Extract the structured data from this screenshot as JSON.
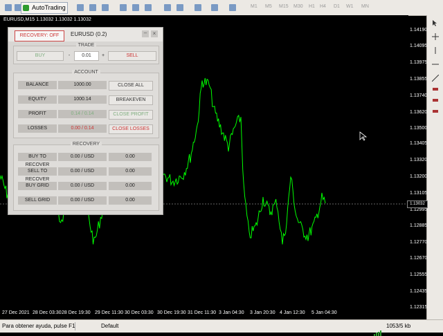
{
  "toolbar": {
    "autotrading_label": "AutoTrading",
    "timeframes": [
      "M1",
      "M5",
      "M15",
      "M30",
      "H1",
      "H4",
      "D1",
      "W1",
      "MN"
    ]
  },
  "chart": {
    "title": "EURUSD,M15  1.13032 1.13032 1.13032",
    "price_labels": [
      "1.14190",
      "1.14095",
      "1.13975",
      "1.13855",
      "1.13740",
      "1.13620",
      "1.13500",
      "1.13405",
      "1.13320",
      "1.13200",
      "1.13105",
      "1.12995",
      "1.12885",
      "1.12770",
      "1.12670",
      "1.12555",
      "1.12435",
      "1.12315"
    ],
    "current_price": "1.13032",
    "time_labels": [
      "27 Dec 2021",
      "28 Dec 03:30",
      "28 Dec 19:30",
      "29 Dec 11:30",
      "30 Dec 03:30",
      "30 Dec 19:30",
      "31 Dec 11:30",
      "3 Jan 04:30",
      "3 Jan 20:30",
      "4 Jan 12:30",
      "5 Jan 04:30"
    ],
    "line_color": "#00ff00",
    "background": "#000000"
  },
  "panel": {
    "recovery_label": "RECOVERY: OFF",
    "symbol_label": "EURUSD (0.2)",
    "trade": {
      "title": "TRADE",
      "buy": "BUY",
      "lot_minus": "-",
      "lot_value": "0.01",
      "lot_plus": "+",
      "sell": "SELL"
    },
    "account": {
      "title": "ACCOUNT",
      "rows": [
        {
          "label": "BALANCE",
          "value": "1000.00",
          "action": "CLOSE ALL"
        },
        {
          "label": "EQUITY",
          "value": "1000.14",
          "action": "BREAKEVEN"
        },
        {
          "label": "PROFIT",
          "value": "0.14 / 0.14",
          "action": "CLOSE PROFIT"
        },
        {
          "label": "LOSSES",
          "value": "0.00 / 0.14",
          "action": "CLOSE LOSSES"
        }
      ]
    },
    "recovery": {
      "title": "RECOVERY",
      "rows": [
        {
          "label": "BUY TO RECOVER",
          "value": "0.00 / USD",
          "extra": "0.00"
        },
        {
          "label": "SELL TO RECOVER",
          "value": "0.00 / USD",
          "extra": "0.00"
        },
        {
          "label": "BUY GRID",
          "value": "0.00 / USD",
          "extra": "0.00"
        },
        {
          "label": "SELL GRID",
          "value": "0.00 / USD",
          "extra": "0.00"
        }
      ]
    }
  },
  "status": {
    "help": "Para obtener ayuda, pulse F1",
    "profile": "Default",
    "traffic": "1053/5 kb"
  }
}
